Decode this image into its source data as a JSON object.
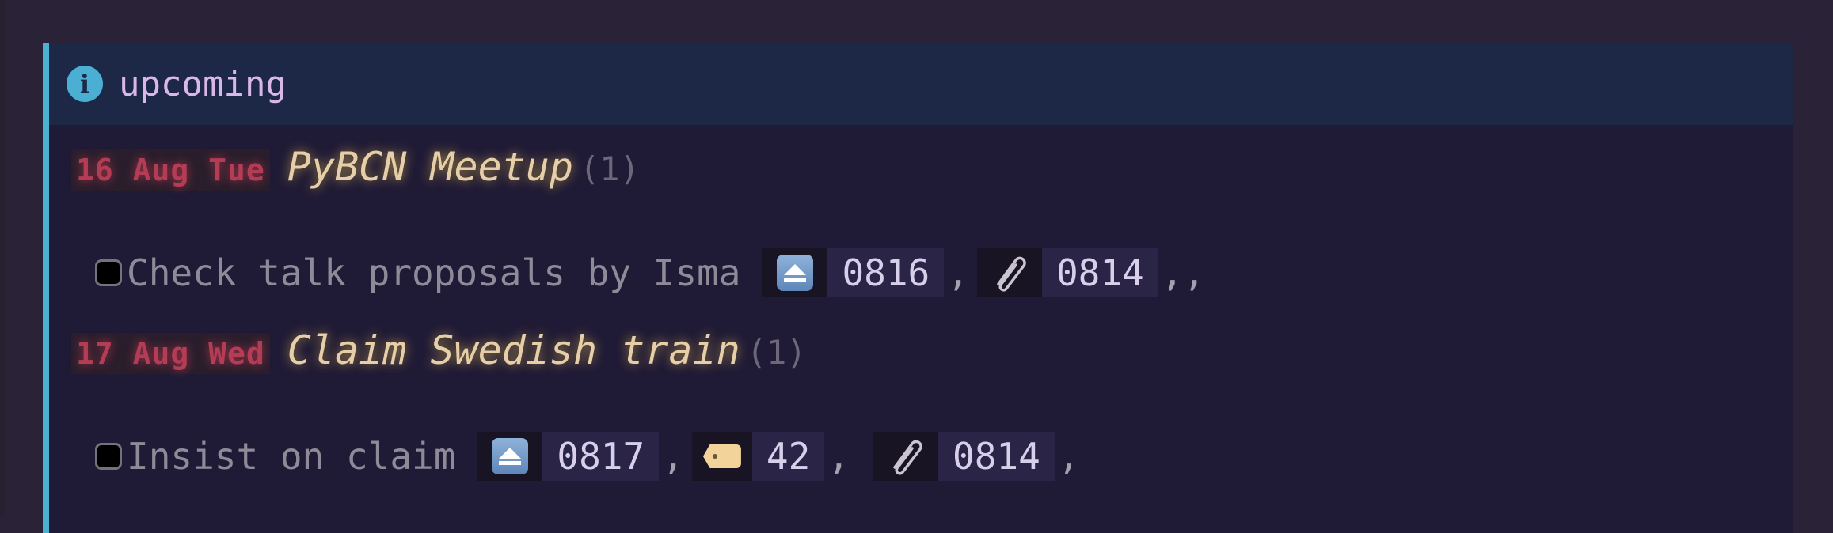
{
  "callout": {
    "type_icon": "info-icon",
    "title": "upcoming"
  },
  "days": [
    {
      "date": "16 Aug Tue",
      "title": "PyBCN Meetup",
      "count": "(1)",
      "tasks": [
        {
          "checked": false,
          "text": "Check talk proposals by Isma",
          "chips": [
            {
              "icon": "eject-icon",
              "value": "0816",
              "sep": ","
            },
            {
              "icon": "paperclip-icon",
              "value": "0814",
              "sep": ",,"
            }
          ]
        }
      ]
    },
    {
      "date": "17 Aug Wed",
      "title": "Claim Swedish train",
      "count": "(1)",
      "tasks": [
        {
          "checked": false,
          "text": "Insist on claim",
          "chips": [
            {
              "icon": "eject-icon",
              "value": "0817",
              "sep": ","
            },
            {
              "icon": "tag-icon",
              "value": "42",
              "sep": ","
            },
            {
              "icon": "paperclip-icon",
              "value": "0814",
              "sep": ","
            }
          ]
        }
      ]
    }
  ],
  "colors": {
    "accent": "#4bb3d1",
    "date": "#b43c55",
    "event_title": "#e6cfa8",
    "background": "#1f1a36"
  }
}
